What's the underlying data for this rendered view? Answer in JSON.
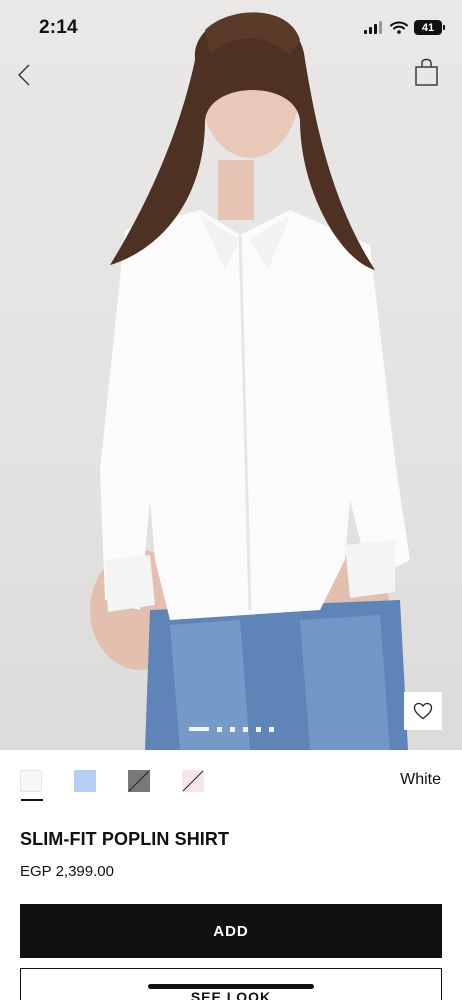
{
  "status_bar": {
    "time": "2:14",
    "battery": "41"
  },
  "nav": {
    "back_icon": "chevron-left-icon",
    "bag_icon": "shopping-bag-icon"
  },
  "gallery": {
    "image_count": 6,
    "active_index": 0,
    "wishlist_icon": "heart-icon"
  },
  "colors": {
    "selected_name": "White",
    "swatches": [
      {
        "name": "White",
        "hex": "#f7f7f7",
        "available": true
      },
      {
        "name": "Light blue",
        "hex": "#b7cef4",
        "available": true
      },
      {
        "name": "Grey",
        "hex": "#7a7876",
        "available": false
      },
      {
        "name": "Pink",
        "hex": "#f8e6ec",
        "available": false
      }
    ]
  },
  "product": {
    "name": "SLIM-FIT POPLIN SHIRT",
    "price": "EGP 2,399.00"
  },
  "actions": {
    "add_label": "ADD",
    "see_look_label": "SEE LOOK"
  }
}
